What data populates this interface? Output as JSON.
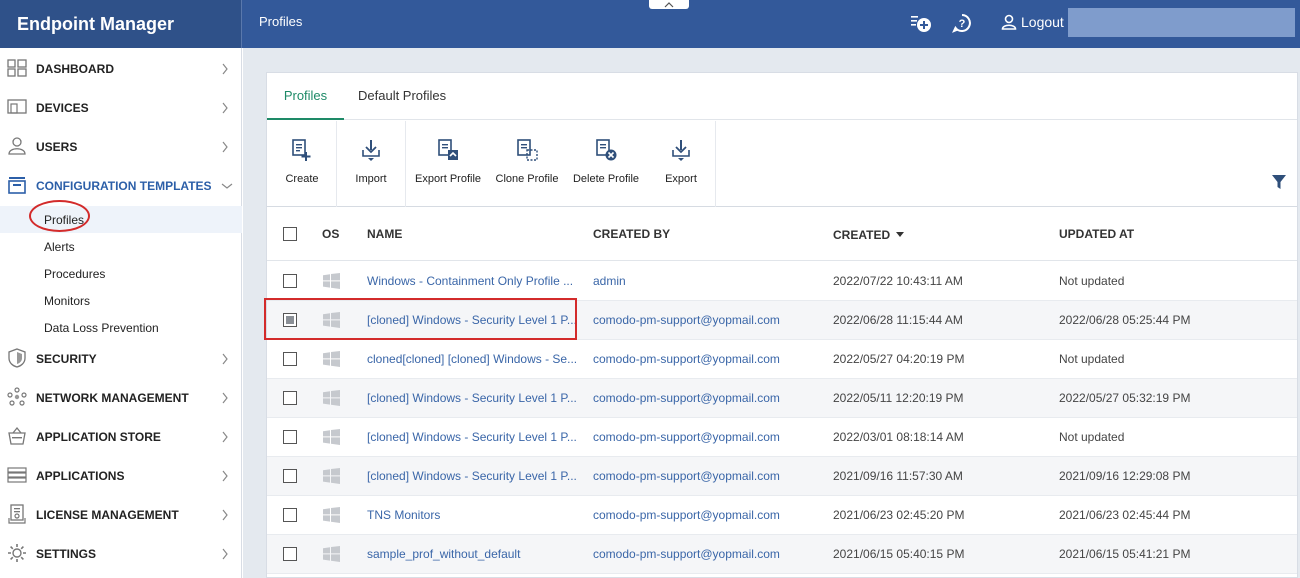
{
  "app": {
    "title": "Endpoint Manager"
  },
  "header": {
    "breadcrumb": "Profiles",
    "logout_label": "Logout"
  },
  "sidebar": {
    "items": [
      {
        "label": "DASHBOARD",
        "icon": "dashboard-icon"
      },
      {
        "label": "DEVICES",
        "icon": "devices-icon"
      },
      {
        "label": "USERS",
        "icon": "users-icon"
      },
      {
        "label": "CONFIGURATION TEMPLATES",
        "icon": "templates-icon",
        "expanded": true
      },
      {
        "label": "SECURITY",
        "icon": "shield-icon"
      },
      {
        "label": "NETWORK MANAGEMENT",
        "icon": "network-icon"
      },
      {
        "label": "APPLICATION STORE",
        "icon": "store-icon"
      },
      {
        "label": "APPLICATIONS",
        "icon": "applications-icon"
      },
      {
        "label": "LICENSE MANAGEMENT",
        "icon": "license-icon"
      },
      {
        "label": "SETTINGS",
        "icon": "gear-icon"
      }
    ],
    "subitems": [
      {
        "label": "Profiles",
        "selected": true
      },
      {
        "label": "Alerts"
      },
      {
        "label": "Procedures"
      },
      {
        "label": "Monitors"
      },
      {
        "label": "Data Loss Prevention"
      }
    ]
  },
  "tabs": [
    {
      "label": "Profiles",
      "active": true
    },
    {
      "label": "Default Profiles"
    }
  ],
  "toolbar": {
    "create": "Create",
    "import": "Import",
    "export_profile": "Export Profile",
    "clone_profile": "Clone Profile",
    "delete_profile": "Delete Profile",
    "export": "Export"
  },
  "table": {
    "columns": {
      "os": "OS",
      "name": "NAME",
      "created_by": "CREATED BY",
      "created": "CREATED",
      "updated_at": "UPDATED AT"
    },
    "sort_column": "CREATED",
    "rows": [
      {
        "name": "Windows - Containment Only Profile ...",
        "created_by": "admin",
        "created": "2022/07/22 10:43:11 AM",
        "updated": "Not updated",
        "checked": false
      },
      {
        "name": "[cloned] Windows - Security Level 1 P...",
        "created_by": "comodo-pm-support@yopmail.com",
        "created": "2022/06/28 11:15:44 AM",
        "updated": "2022/06/28 05:25:44 PM",
        "checked": true
      },
      {
        "name": "cloned[cloned] [cloned] Windows - Se...",
        "created_by": "comodo-pm-support@yopmail.com",
        "created": "2022/05/27 04:20:19 PM",
        "updated": "Not updated",
        "checked": false
      },
      {
        "name": "[cloned] Windows - Security Level 1 P...",
        "created_by": "comodo-pm-support@yopmail.com",
        "created": "2022/05/11 12:20:19 PM",
        "updated": "2022/05/27 05:32:19 PM",
        "checked": false
      },
      {
        "name": "[cloned] Windows - Security Level 1 P...",
        "created_by": "comodo-pm-support@yopmail.com",
        "created": "2022/03/01 08:18:14 AM",
        "updated": "Not updated",
        "checked": false
      },
      {
        "name": "[cloned] Windows - Security Level 1 P...",
        "created_by": "comodo-pm-support@yopmail.com",
        "created": "2021/09/16 11:57:30 AM",
        "updated": "2021/09/16 12:29:08 PM",
        "checked": false
      },
      {
        "name": "TNS Monitors",
        "created_by": "comodo-pm-support@yopmail.com",
        "created": "2021/06/23 02:45:20 PM",
        "updated": "2021/06/23 02:45:44 PM",
        "checked": false
      },
      {
        "name": "sample_prof_without_default",
        "created_by": "comodo-pm-support@yopmail.com",
        "created": "2021/06/15 05:40:15 PM",
        "updated": "2021/06/15 05:41:21 PM",
        "checked": false
      }
    ]
  },
  "colors": {
    "header": "#33599a",
    "brand": "#2f5189",
    "link": "#3a66a8",
    "active_tab": "#1e8a67",
    "annotation": "#d32b2b"
  }
}
